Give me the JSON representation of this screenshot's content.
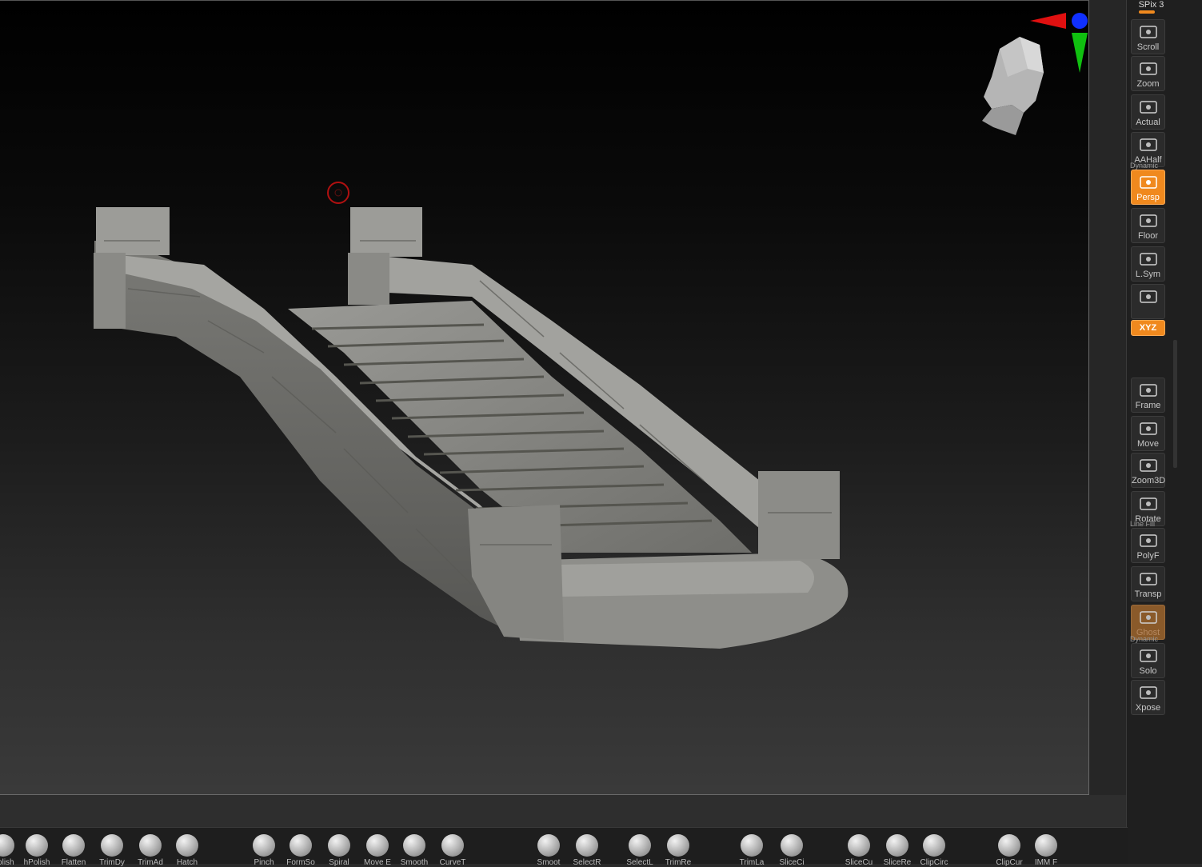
{
  "viewport": {
    "spix_label": "SPix 3"
  },
  "right_shelf": {
    "buttons": [
      {
        "label": "Scroll"
      },
      {
        "label": "Zoom"
      },
      {
        "label": "Actual"
      },
      {
        "label": "AAHalf"
      },
      {
        "label": "Persp",
        "active": true,
        "top_label": "Dynamic"
      },
      {
        "label": "Floor"
      },
      {
        "label": "L.Sym"
      },
      {
        "label": ""
      },
      {
        "label": "XYZ",
        "active": true
      },
      {
        "label": "Frame"
      },
      {
        "label": "Move"
      },
      {
        "label": "Zoom3D"
      },
      {
        "label": "Rotate"
      },
      {
        "label": "PolyF",
        "top_label": "Line Fill"
      },
      {
        "label": "Transp"
      },
      {
        "label": "Ghost",
        "ghost": true
      },
      {
        "label": "Solo",
        "top_label": "Dynamic"
      },
      {
        "label": "Xpose"
      }
    ]
  },
  "bottom_shelf": {
    "brushes": [
      {
        "label": "Polish"
      },
      {
        "label": "hPolish"
      },
      {
        "label": "Flatten"
      },
      {
        "label": "TrimDy"
      },
      {
        "label": "TrimAd"
      },
      {
        "label": "Hatch"
      },
      {
        "label": "Pinch"
      },
      {
        "label": "FormSo"
      },
      {
        "label": "Spiral"
      },
      {
        "label": "Move E"
      },
      {
        "label": "Smooth"
      },
      {
        "label": "CurveT"
      },
      {
        "label": "Smoot"
      },
      {
        "label": "SelectR"
      },
      {
        "label": "SelectL"
      },
      {
        "label": "TrimRe"
      },
      {
        "label": "TrimLa"
      },
      {
        "label": "SliceCi"
      },
      {
        "label": "SliceCu"
      },
      {
        "label": "SliceRe"
      },
      {
        "label": "ClipCirc"
      },
      {
        "label": "ClipCur"
      },
      {
        "label": "IMM F"
      }
    ]
  },
  "colors": {
    "accent": "#f0891e",
    "axis_x": "#e01010",
    "axis_y": "#10c010",
    "axis_z": "#1030ff"
  }
}
